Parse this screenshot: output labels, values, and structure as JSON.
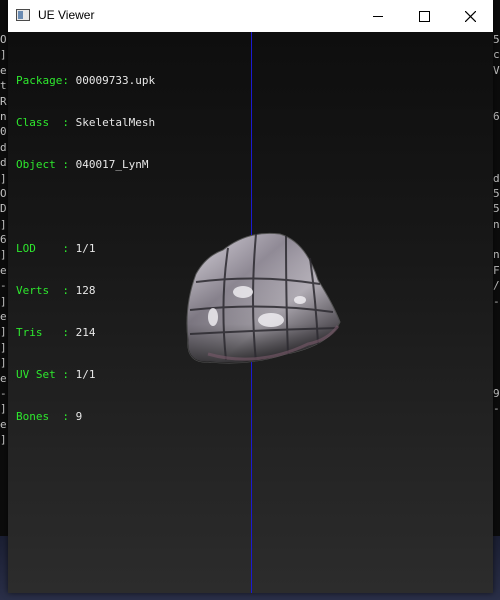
{
  "window": {
    "title": "UE Viewer"
  },
  "info": {
    "package": {
      "label": "Package:",
      "value": "00009733.upk"
    },
    "class": {
      "label": "Class  :",
      "value": "SkeletalMesh"
    },
    "object": {
      "label": "Object :",
      "value": "040017_LynM"
    },
    "lod": {
      "label": "LOD    :",
      "value": "1/1"
    },
    "verts": {
      "label": "Verts  :",
      "value": "128"
    },
    "tris": {
      "label": "Tris   :",
      "value": "214"
    },
    "uvset": {
      "label": "UV Set :",
      "value": "1/1"
    },
    "bones": {
      "label": "Bones  :",
      "value": "9"
    }
  },
  "background_console": {
    "left": [
      "O",
      "]",
      "e",
      "t",
      "R",
      "n",
      "0",
      "d",
      "d",
      "]",
      "O",
      "D",
      "]",
      "6",
      "]",
      "e",
      "-",
      "]",
      "e",
      "]",
      "]",
      "]",
      "e",
      "-",
      "]",
      "e",
      "]"
    ],
    "right": [
      "5",
      "c",
      "V",
      "",
      "",
      "6",
      "",
      "",
      "",
      "d",
      "5",
      "5",
      "n",
      "",
      "n",
      "F",
      "/",
      "-",
      "",
      "",
      "",
      "",
      "",
      "9",
      "-",
      "",
      ""
    ]
  },
  "colors": {
    "label_green": "#2ee82e",
    "axis_blue": "#1a1ad0",
    "viewport_top": "#0e0e0e",
    "viewport_bottom": "#2c2c2c"
  },
  "icons": [
    "app-icon",
    "minimize-icon",
    "maximize-icon",
    "close-icon"
  ]
}
